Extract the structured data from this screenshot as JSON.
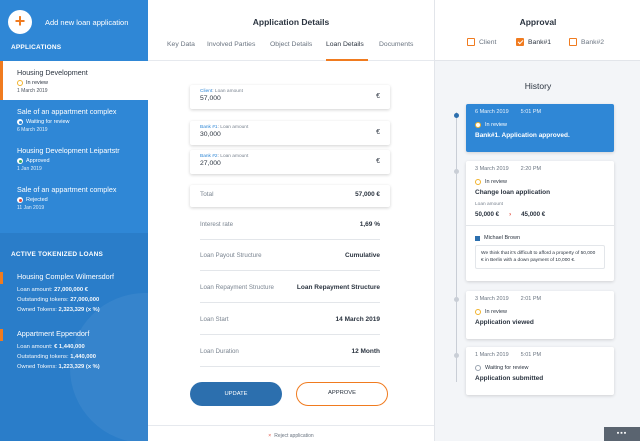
{
  "sidebar": {
    "add_label": "Add new loan application",
    "add_icon": "+",
    "applications_title": "APPLICATIONS",
    "applications": [
      {
        "name": "Housing Development",
        "status": "In review",
        "date": "1 March 2019"
      },
      {
        "name": "Sale of an appartment complex",
        "status": "Waiting for review",
        "date": "6 March 2019"
      },
      {
        "name": "Housing Development Leipartstr",
        "status": "Approved",
        "date": "1 Jan 2019"
      },
      {
        "name": "Sale of an appartment complex",
        "status": "Rejected",
        "date": "11 Jan 2019"
      }
    ],
    "tokenized_title": "ACTIVE TOKENIZED LOANS",
    "tokenized": [
      {
        "name": "Housing Complex Wilmersdorf",
        "loan_label": "Loan amount:",
        "loan_value": "27,000,000 €",
        "outstanding_label": "Outstanding tokens:",
        "outstanding_value": "27,000,000",
        "owned_label": "Owned Tokens:",
        "owned_value": "2,323,329 (x %)"
      },
      {
        "name": "Appartment Eppendorf",
        "loan_label": "Loan amount:",
        "loan_value": "€ 1,440,000",
        "outstanding_label": "Outstanding tokens:",
        "outstanding_value": "1,440,000",
        "owned_label": "Owned Tokens:",
        "owned_value": "1,223,329 (x %)"
      }
    ]
  },
  "main": {
    "title": "Application Details",
    "tabs": [
      "Key Data",
      "Involved Parties",
      "Object Details",
      "Loan Details",
      "Documents"
    ],
    "amounts": [
      {
        "party": "Client",
        "label": ": Loan amount",
        "value": "57,000",
        "currency": "€"
      },
      {
        "party": "Bank #1",
        "label": ": Loan amount",
        "value": "30,000",
        "currency": "€"
      },
      {
        "party": "Bank #2",
        "label": ": Loan amount",
        "value": "27,000",
        "currency": "€"
      }
    ],
    "total_label": "Total",
    "total_value": "57,000 €",
    "details": [
      {
        "label": "Interest rate",
        "value": "1,69 %"
      },
      {
        "label": "Loan Payout Structure",
        "value": "Cumulative"
      },
      {
        "label": "Loan Repayment Structure",
        "value": "Loan Repayment Structure"
      },
      {
        "label": "Loan Start",
        "value": "14 March 2019"
      },
      {
        "label": "Loan Duration",
        "value": "12 Month"
      }
    ],
    "update_label": "UPDATE",
    "approve_label": "APPROVE",
    "reject_icon": "×",
    "reject_label": "Reject application"
  },
  "approval": {
    "title": "Approval",
    "options": [
      {
        "label": "Client",
        "checked": false
      },
      {
        "label": "Bank#1",
        "checked": true
      },
      {
        "label": "Bank#2",
        "checked": false
      }
    ]
  },
  "history": {
    "title": "History",
    "entries": [
      {
        "date": "6 March 2019",
        "time": "5:01 PM",
        "status": "In review",
        "text": "Bank#1. Application approved."
      },
      {
        "date": "3 March 2019",
        "time": "2:20 PM",
        "status": "In review",
        "text": "Change loan application",
        "amount_label": "Loan amount",
        "from": "50,000 €",
        "arrow": "›",
        "to": "45,000 €",
        "user": "Michael Brown",
        "comment": "We think that it's difficult to afford a property of 50,000 € in Berlin with a down payment of 10,000 €."
      },
      {
        "date": "3 March 2019",
        "time": "2:01 PM",
        "status": "In review",
        "text": "Application viewed"
      },
      {
        "date": "1 March 2019",
        "time": "5:01 PM",
        "status": "Waiting for review",
        "text": "Application submitted"
      }
    ]
  },
  "grid_icon": "▪▪▪",
  "colors": {
    "accent": "#f07b1f",
    "primary": "#2f87d6",
    "dark_blue": "#2c6fae",
    "reject": "#e24a3b"
  }
}
